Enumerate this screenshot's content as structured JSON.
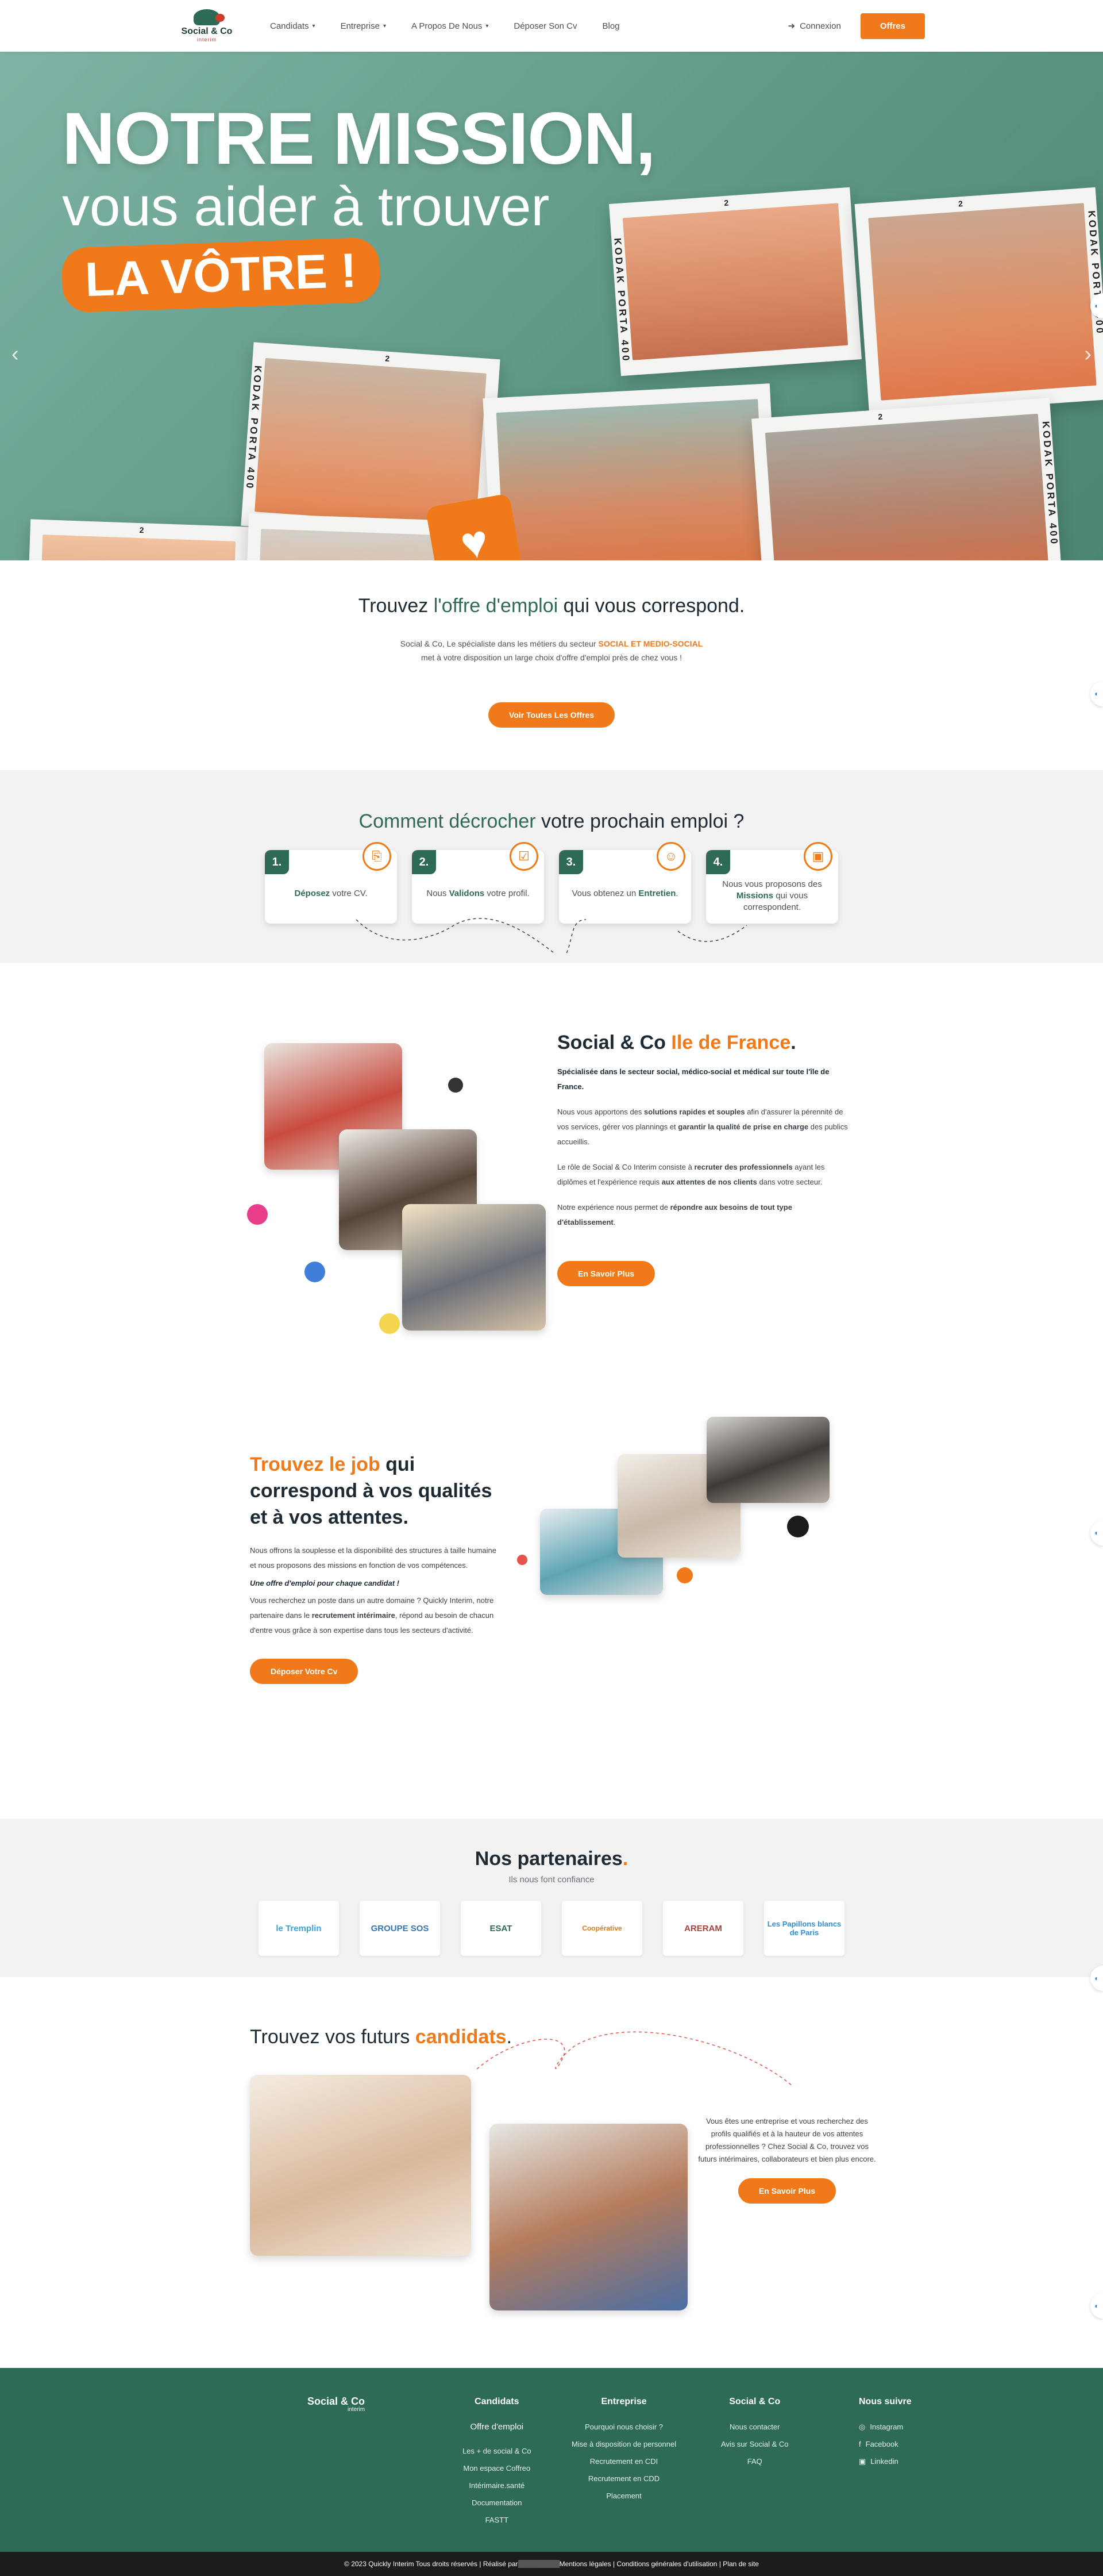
{
  "header": {
    "logo_text": "Social & Co",
    "logo_sub": "interim",
    "nav": [
      {
        "label": "Candidats",
        "dropdown": true
      },
      {
        "label": "Entreprise",
        "dropdown": true
      },
      {
        "label": "A Propos De Nous",
        "dropdown": true
      },
      {
        "label": "Déposer Son Cv",
        "dropdown": false
      },
      {
        "label": "Blog",
        "dropdown": false
      }
    ],
    "login_label": "Connexion",
    "offers_button": "Offres"
  },
  "hero": {
    "line1": "NOTRE MISSION,",
    "line2": "vous aider à trouver",
    "line3": "LA VÔTRE !",
    "film_brand": "KODAK  PORTA 400",
    "frame_numbers": [
      "2",
      "2",
      "2",
      "2",
      "2",
      "2",
      "2",
      "2"
    ],
    "prev_arrow": "‹",
    "next_arrow": "›"
  },
  "offers": {
    "title_prefix": "Trouvez ",
    "title_highlight": "l'offre d'emploi",
    "title_suffix": " qui vous correspond.",
    "text_1": "Social & Co, Le spécialiste dans les métiers du secteur ",
    "text_highlight": "SOCIAL ET MEDIO-SOCIAL",
    "text_2": "met à votre disposition  un large choix d'offre d'emploi près de chez vous !",
    "button": "Voir Toutes Les Offres"
  },
  "steps": {
    "title_highlight": "Comment décrocher",
    "title_suffix": " votre prochain emploi ?",
    "items": [
      {
        "num": "1.",
        "pre": "",
        "hl": "Déposez",
        "post": " votre CV."
      },
      {
        "num": "2.",
        "pre": "Nous ",
        "hl": "Validons",
        "post": " votre profil."
      },
      {
        "num": "3.",
        "pre": "Vous obtenez un ",
        "hl": "Entretien",
        "post": "."
      },
      {
        "num": "4.",
        "pre": "Nous vous proposons des ",
        "hl": "Missions",
        "post": " qui vous correspondent."
      }
    ]
  },
  "about": {
    "title": "Social & Co ",
    "title_highlight": "Ile de France",
    "title_dot": ".",
    "p1": "Spécialisée dans le secteur social, médico-social et médical sur toute l'île de France.",
    "p2_a": "Nous vous apportons des ",
    "p2_b": "solutions rapides et souples",
    "p2_c": " afin d'assurer la pérennité de vos services, gérer vos plannings et ",
    "p2_d": "garantir la qualité de prise en charge",
    "p2_e": " des publics accueillis.",
    "p3_a": "Le rôle de Social & Co Interim consiste à ",
    "p3_b": "recruter des professionnels",
    "p3_c": " ayant les diplômes et l'expérience requis ",
    "p3_d": "aux attentes de nos clients",
    "p3_e": " dans votre secteur.",
    "p4_a": "Notre expérience nous permet de ",
    "p4_b": "répondre aux besoins de tout type d'établissement",
    "p4_c": ".",
    "button": "En Savoir Plus"
  },
  "job": {
    "title_highlight": "Trouvez le job",
    "title_rest": " qui correspond à vos qualités et à vos attentes.",
    "p1": "Nous offrons la souplesse et la disponibilité des structures à taille humaine et nous proposons des missions en fonction de vos compétences.",
    "italic": "Une offre d'emploi pour chaque candidat !",
    "p2_a": "Vous recherchez un poste dans un autre domaine ? Quickly Interim, notre partenaire dans le ",
    "p2_b": "recrutement intérimaire",
    "p2_c": ", répond au besoin de chacun d'entre vous grâce à son expertise dans tous les secteurs d'activité.",
    "button": "Déposer Votre Cv"
  },
  "partners": {
    "title": "Nos partenaires",
    "title_dot": ".",
    "subtitle": "Ils nous font confiance",
    "logos": [
      "le Tremplin",
      "GROUPE SOS",
      "ESAT",
      "Coopérative",
      "ARERAM",
      "Les Papillons blancs de Paris"
    ]
  },
  "candidates": {
    "title": "Trouvez vos futurs ",
    "title_highlight": "candidats",
    "title_dot": ".",
    "text": "Vous êtes une entreprise et vous recherchez des profils qualifiés et à la hauteur de vos attentes professionnelles ? Chez Social & Co, trouvez vos futurs intérimaires, collaborateurs et bien plus encore.",
    "button": "En Savoir Plus"
  },
  "footer": {
    "logo": "Social & Co",
    "logo_sub": "interim",
    "col1_title": "Candidats",
    "col1_special": "Offre d'emploi",
    "col1_items": [
      "Les + de social & Co",
      "Mon espace Coffreo",
      "Intérimaire.santé",
      "Documentation",
      "FASTT"
    ],
    "col2_title": "Entreprise",
    "col2_items": [
      "Pourquoi nous choisir ?",
      "Mise à disposition de personnel",
      "Recrutement en CDI",
      "Recrutement en CDD",
      "Placement"
    ],
    "col3_title": "Social & Co",
    "col3_items": [
      "Nous contacter",
      "Avis sur Social & Co",
      "FAQ"
    ],
    "col4_title": "Nous suivre",
    "col4_items": [
      "Instagram",
      "Facebook",
      "Linkedin"
    ],
    "bottom_a": "© 2023 Quickly Interim Tous droits réservés | Réalisé par ",
    "bottom_mask": "XXXXXXXX",
    "bottom_b": " Mentions légales | Conditions générales d'utilisation | Plan de site"
  },
  "colors": {
    "green": "#2e6b55",
    "orange": "#f07a1a"
  }
}
